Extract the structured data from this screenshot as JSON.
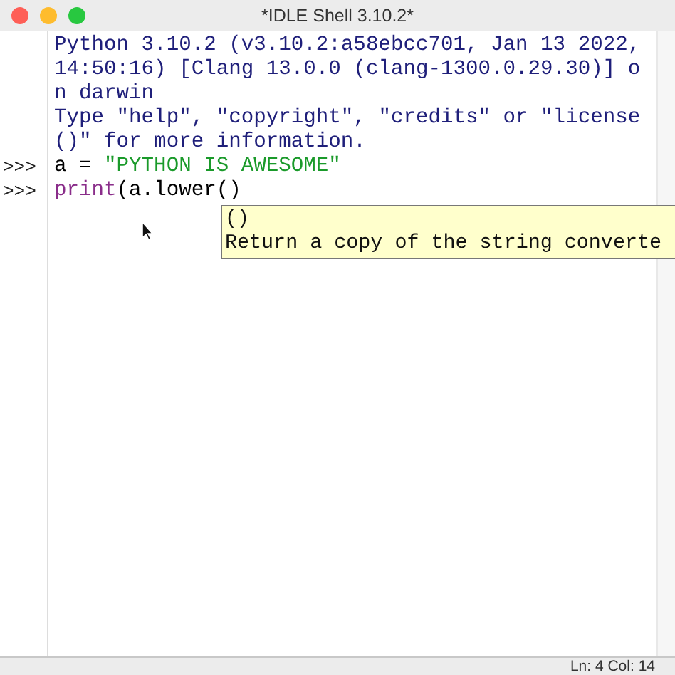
{
  "window": {
    "title": "*IDLE Shell 3.10.2*",
    "buttons": [
      {
        "kind": "close"
      },
      {
        "kind": "minimize"
      },
      {
        "kind": "zoom"
      }
    ]
  },
  "shell": {
    "lines": [
      {
        "kind": "output",
        "segments": [
          {
            "kind": "output",
            "text": "Python 3.10.2 (v3.10.2:a58ebcc701, Jan 13 2022,"
          }
        ]
      },
      {
        "kind": "output",
        "segments": [
          {
            "kind": "output",
            "text": "14:50:16) [Clang 13.0.0 (clang-1300.0.29.30)] o"
          }
        ]
      },
      {
        "kind": "output",
        "segments": [
          {
            "kind": "output",
            "text": "n darwin"
          }
        ]
      },
      {
        "kind": "output",
        "segments": [
          {
            "kind": "output",
            "text": "Type \"help\", \"copyright\", \"credits\" or \"license"
          }
        ]
      },
      {
        "kind": "output",
        "segments": [
          {
            "kind": "output",
            "text": "()\" for more information."
          }
        ]
      },
      {
        "kind": "input",
        "prompt": ">>>",
        "segments": [
          {
            "kind": "plain",
            "text": "a = "
          },
          {
            "kind": "string",
            "text": "\"PYTHON IS AWESOME\""
          }
        ]
      },
      {
        "kind": "input",
        "prompt": ">>>",
        "segments": [
          {
            "kind": "builtin",
            "text": "print"
          },
          {
            "kind": "plain",
            "text": "(a.lower()"
          }
        ]
      }
    ]
  },
  "calltip": {
    "signature": "()",
    "description": "Return a copy of the string converte"
  },
  "status_bar": {
    "position": "Ln: 4  Col: 14"
  }
}
